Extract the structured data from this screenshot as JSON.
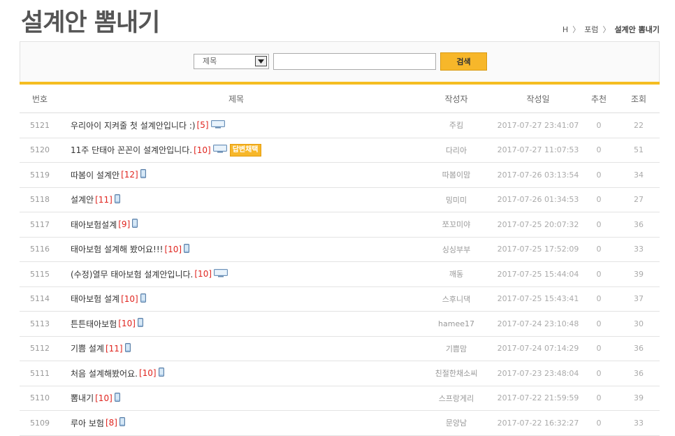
{
  "page": {
    "title": "설계안 뽐내기",
    "breadcrumb": {
      "home": "H",
      "sep": "〉",
      "forum": "포럼",
      "current": "설계안 뽐내기"
    }
  },
  "search": {
    "select_value": "제목",
    "input_value": "",
    "button_label": "검색"
  },
  "table": {
    "headers": {
      "num": "번호",
      "title": "제목",
      "author": "작성자",
      "date": "작성일",
      "rec": "추천",
      "views": "조회"
    },
    "rows": [
      {
        "num": "5121",
        "title": "우리아이 지켜줄 첫 설계안입니다 :)",
        "comments": "[5]",
        "icon": "desktop-icon",
        "badge": "",
        "author": "주킴",
        "date": "2017-07-27 23:41:07",
        "rec": "0",
        "views": "22"
      },
      {
        "num": "5120",
        "title": "11주 단태아 꼰꼰이 설계안입니다.",
        "comments": "[10]",
        "icon": "desktop-icon",
        "badge": "답변채택",
        "author": "다리아",
        "date": "2017-07-27 11:07:53",
        "rec": "0",
        "views": "51"
      },
      {
        "num": "5119",
        "title": "따봄이 설계안",
        "comments": "[12]",
        "icon": "mobile-icon",
        "badge": "",
        "author": "따봄이맘",
        "date": "2017-07-26 03:13:54",
        "rec": "0",
        "views": "34"
      },
      {
        "num": "5118",
        "title": "설계안",
        "comments": "[11]",
        "icon": "mobile-icon",
        "badge": "",
        "author": "밍미미",
        "date": "2017-07-26 01:34:53",
        "rec": "0",
        "views": "27"
      },
      {
        "num": "5117",
        "title": "태아보험설계",
        "comments": "[9]",
        "icon": "mobile-icon",
        "badge": "",
        "author": "쪼꼬미야",
        "date": "2017-07-25 20:07:32",
        "rec": "0",
        "views": "36"
      },
      {
        "num": "5116",
        "title": "태아보험 설계해 봤어요!!!",
        "comments": "[10]",
        "icon": "mobile-icon",
        "badge": "",
        "author": "싱싱부부",
        "date": "2017-07-25 17:52:09",
        "rec": "0",
        "views": "33"
      },
      {
        "num": "5115",
        "title": "(수정)열무 태아보험 설계안입니다.",
        "comments": "[10]",
        "icon": "desktop-icon",
        "badge": "",
        "author": "깨동",
        "date": "2017-07-25 15:44:04",
        "rec": "0",
        "views": "39"
      },
      {
        "num": "5114",
        "title": "태아보험 설계",
        "comments": "[10]",
        "icon": "mobile-icon",
        "badge": "",
        "author": "스후니댁",
        "date": "2017-07-25 15:43:41",
        "rec": "0",
        "views": "37"
      },
      {
        "num": "5113",
        "title": "튼튼태아보험",
        "comments": "[10]",
        "icon": "mobile-icon",
        "badge": "",
        "author": "hamee17",
        "date": "2017-07-24 23:10:48",
        "rec": "0",
        "views": "30"
      },
      {
        "num": "5112",
        "title": "기쁨 설계",
        "comments": "[11]",
        "icon": "mobile-icon",
        "badge": "",
        "author": "기쁨맘",
        "date": "2017-07-24 07:14:29",
        "rec": "0",
        "views": "36"
      },
      {
        "num": "5111",
        "title": "처음 설계해봤어요.",
        "comments": "[10]",
        "icon": "mobile-icon",
        "badge": "",
        "author": "친절한채소씨",
        "date": "2017-07-23 23:48:04",
        "rec": "0",
        "views": "36"
      },
      {
        "num": "5110",
        "title": "뽐내기",
        "comments": "[10]",
        "icon": "mobile-icon",
        "badge": "",
        "author": "스프랑게리",
        "date": "2017-07-22 21:59:59",
        "rec": "0",
        "views": "39"
      },
      {
        "num": "5109",
        "title": "루아 보험",
        "comments": "[8]",
        "icon": "mobile-icon",
        "badge": "",
        "author": "문양남",
        "date": "2017-07-22 16:32:27",
        "rec": "0",
        "views": "33"
      }
    ]
  }
}
